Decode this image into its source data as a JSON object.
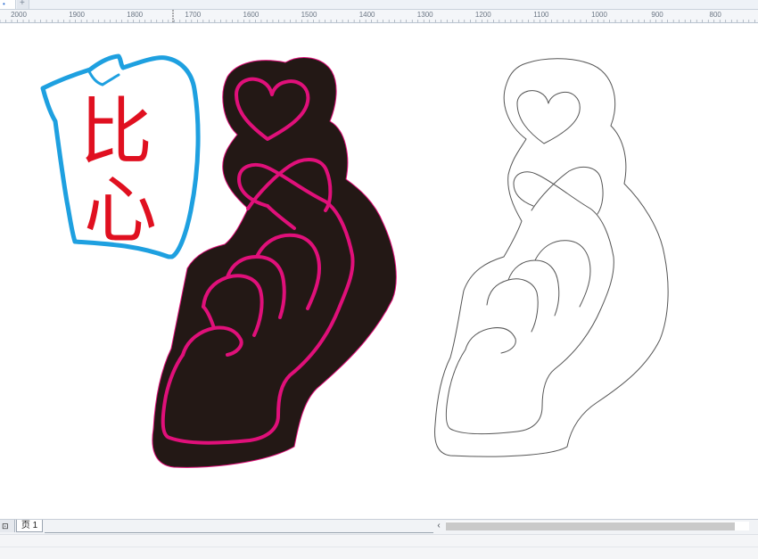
{
  "window": {
    "tab_dot": "•",
    "tab_add": "+"
  },
  "ruler": {
    "labels": [
      "2000",
      "1900",
      "1800",
      "1700",
      "1600",
      "1500",
      "1400",
      "1300",
      "1200",
      "1100",
      "1000",
      "900",
      "800"
    ]
  },
  "artwork": {
    "sticker_text_top": "比",
    "sticker_text_bottom": "心"
  },
  "page_tabs": {
    "first_icon": "⊡",
    "current": "页 1"
  },
  "scrollbar": {
    "left_arrow": "‹"
  },
  "colors": {
    "accent_pink": "#e0107a",
    "red_text": "#e01020",
    "blue_outline": "#1ea0e0",
    "dark_fill": "#231815"
  }
}
